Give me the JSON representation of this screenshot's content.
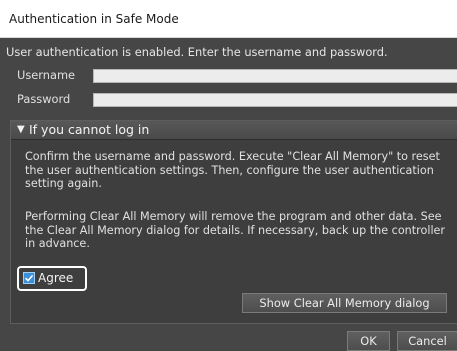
{
  "window": {
    "title": "Authentication in Safe Mode"
  },
  "intro_text": "User authentication is enabled. Enter the username and password.",
  "fields": {
    "username": {
      "label": "Username",
      "value": ""
    },
    "password": {
      "label": "Password",
      "value": ""
    }
  },
  "section": {
    "header": "If you cannot log in",
    "chevron_icon": "triangle-down-icon",
    "paragraph_1": "Confirm the username and password. Execute \"Clear All Memory\" to reset the user authentication settings. Then, configure the user authentication setting again.",
    "paragraph_2": "Performing Clear All Memory will remove the program and other data. See the Clear All Memory dialog for details. If necessary, back up the controller in advance.",
    "agree": {
      "label": "Agree",
      "checked": true
    },
    "show_clear_button": "Show Clear All Memory dialog"
  },
  "buttons": {
    "ok": "OK",
    "cancel": "Cancel"
  },
  "colors": {
    "dialog_bg": "#464646",
    "checkbox_accent": "#3a8fd8",
    "highlight_border": "#ffffff"
  }
}
